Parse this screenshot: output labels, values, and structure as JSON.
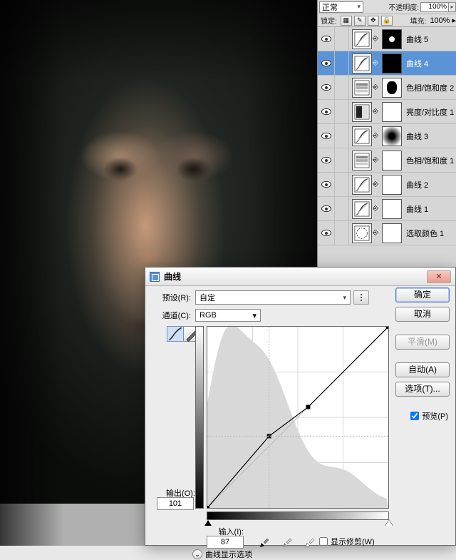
{
  "layers_panel": {
    "blend_mode": "正常",
    "opacity_label": "不透明度:",
    "opacity_value": "100%",
    "lock_label": "锁定:",
    "fill_label": "填充:",
    "fill_value": "100%",
    "layers": [
      {
        "name": "曲线 5",
        "type": "curves",
        "mask": "dot",
        "selected": false
      },
      {
        "name": "曲线 4",
        "type": "curves",
        "mask": "black",
        "selected": true
      },
      {
        "name": "色相/饱和度 2",
        "type": "huesat",
        "mask": "shape",
        "selected": false
      },
      {
        "name": "亮度/对比度 1",
        "type": "bricon",
        "mask": "white",
        "selected": false
      },
      {
        "name": "曲线 3",
        "type": "curves",
        "mask": "grad",
        "selected": false
      },
      {
        "name": "色相/饱和度 1",
        "type": "huesat",
        "mask": "white",
        "selected": false
      },
      {
        "name": "曲线 2",
        "type": "curves",
        "mask": "white",
        "selected": false
      },
      {
        "name": "曲线 1",
        "type": "curves",
        "mask": "white",
        "selected": false
      },
      {
        "name": "选取颜色 1",
        "type": "selcol",
        "mask": "white",
        "selected": false
      }
    ]
  },
  "dialog": {
    "title": "曲线",
    "preset_label": "预设(R):",
    "preset_value": "自定",
    "channel_label": "通道(C):",
    "channel_value": "RGB",
    "output_label": "输出(O):",
    "output_value": "101",
    "input_label": "输入(I):",
    "input_value": "87",
    "show_clipping_label": "显示修剪(W)",
    "curve_display_label": "曲线显示选项",
    "buttons": {
      "ok": "确定",
      "cancel": "取消",
      "smooth": "平滑(M)",
      "auto": "自动(A)",
      "options": "选项(T)...",
      "preview": "预览(P)"
    },
    "chart_data": {
      "type": "line",
      "title": "曲线",
      "xlabel": "输入",
      "ylabel": "输出",
      "xlim": [
        0,
        255
      ],
      "ylim": [
        0,
        255
      ],
      "series": [
        {
          "name": "RGB",
          "points": [
            {
              "x": 0,
              "y": 0
            },
            {
              "x": 87,
              "y": 101
            },
            {
              "x": 142,
              "y": 142
            },
            {
              "x": 255,
              "y": 255
            }
          ]
        }
      ]
    }
  }
}
